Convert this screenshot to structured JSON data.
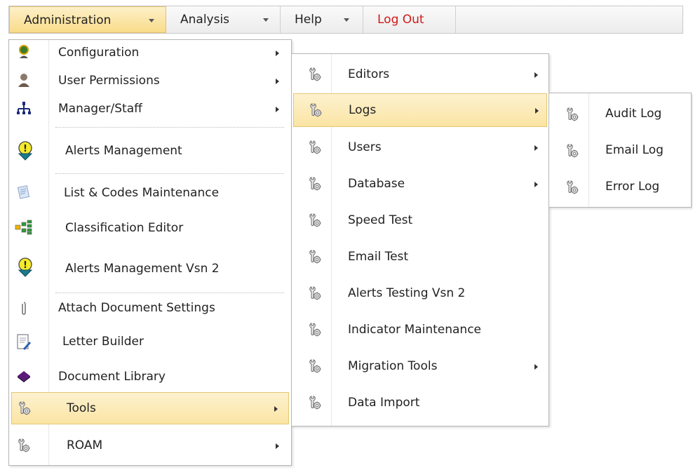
{
  "menubar": {
    "items": [
      {
        "label": "Administration"
      },
      {
        "label": "Analysis"
      },
      {
        "label": "Help"
      },
      {
        "label": "Log Out"
      }
    ]
  },
  "admin_menu": {
    "items": [
      {
        "label": "Configuration",
        "icon": "user-globe-icon"
      },
      {
        "label": "User Permissions",
        "icon": "user-icon"
      },
      {
        "label": "Manager/Staff",
        "icon": "org-chart-icon"
      },
      {
        "label": "Alerts Management",
        "icon": "alert-bulb-icon"
      },
      {
        "label": "List & Codes Maintenance",
        "icon": "list-edit-icon"
      },
      {
        "label": "Classification Editor",
        "icon": "hierarchy-icon"
      },
      {
        "label": "Alerts Management Vsn 2",
        "icon": "alert-bulb-icon"
      },
      {
        "label": "Attach Document Settings",
        "icon": "paperclip-icon"
      },
      {
        "label": "Letter Builder",
        "icon": "document-pen-icon"
      },
      {
        "label": "Document Library",
        "icon": "book-icon"
      },
      {
        "label": "Tools",
        "icon": "tools-icon"
      },
      {
        "label": "ROAM",
        "icon": "tools-icon"
      }
    ]
  },
  "tools_menu": {
    "items": [
      {
        "label": "Editors"
      },
      {
        "label": "Logs"
      },
      {
        "label": "Users"
      },
      {
        "label": "Database"
      },
      {
        "label": "Speed Test"
      },
      {
        "label": "Email Test"
      },
      {
        "label": "Alerts Testing Vsn 2"
      },
      {
        "label": "Indicator Maintenance"
      },
      {
        "label": "Migration Tools"
      },
      {
        "label": "Data Import"
      }
    ]
  },
  "logs_menu": {
    "items": [
      {
        "label": "Audit Log"
      },
      {
        "label": "Email Log"
      },
      {
        "label": "Error Log"
      }
    ]
  },
  "colors": {
    "highlight": "#fbe4a4",
    "logout": "#d01818",
    "border": "#b5b5b5"
  }
}
